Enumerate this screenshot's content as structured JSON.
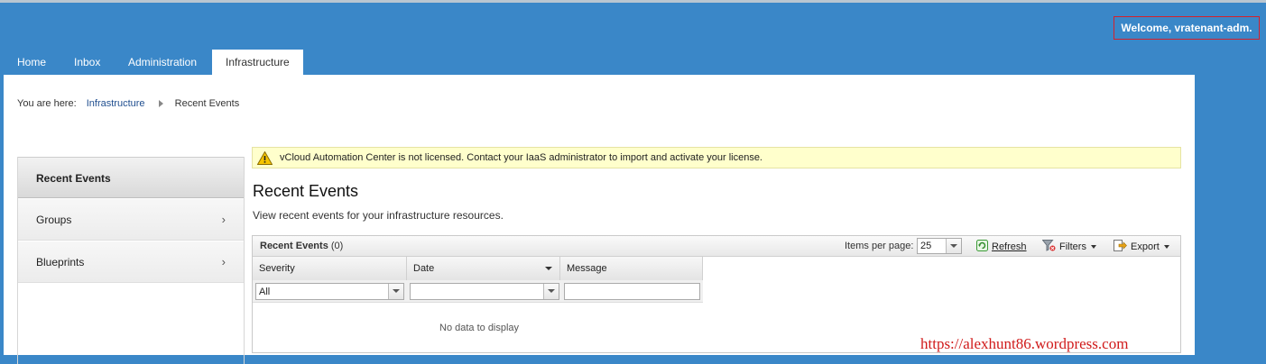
{
  "header": {
    "welcome": "Welcome, vratenant-adm."
  },
  "nav": {
    "tabs": [
      {
        "label": "Home",
        "active": false
      },
      {
        "label": "Inbox",
        "active": false
      },
      {
        "label": "Administration",
        "active": false
      },
      {
        "label": "Infrastructure",
        "active": true
      }
    ]
  },
  "breadcrumb": {
    "prefix": "You are here:",
    "items": [
      "Infrastructure",
      "Recent Events"
    ]
  },
  "sidebar": {
    "items": [
      {
        "label": "Recent Events",
        "active": true
      },
      {
        "label": "Groups",
        "active": false
      },
      {
        "label": "Blueprints",
        "active": false
      }
    ]
  },
  "license_banner": "vCloud Automation Center is not licensed. Contact your IaaS administrator to import and activate your license.",
  "page": {
    "title": "Recent Events",
    "subtitle": "View recent events for your infrastructure resources."
  },
  "grid": {
    "title": "Recent Events",
    "count": "(0)",
    "items_per_page_label": "Items per page:",
    "items_per_page_value": "25",
    "refresh_label": "Refresh",
    "filters_label": "Filters",
    "export_label": "Export",
    "columns": [
      {
        "label": "Severity",
        "filter_value": "All"
      },
      {
        "label": "Date",
        "filter_value": ""
      },
      {
        "label": "Message",
        "filter_value": ""
      }
    ],
    "empty_text": "No data to display"
  },
  "watermark": "https://alexhunt86.wordpress.com",
  "colors": {
    "header_bg": "#3a87c8",
    "welcome_border": "#d6202a",
    "banner_bg": "#ffffcc",
    "link": "#1f4e8f",
    "watermark": "#d01a1a"
  }
}
